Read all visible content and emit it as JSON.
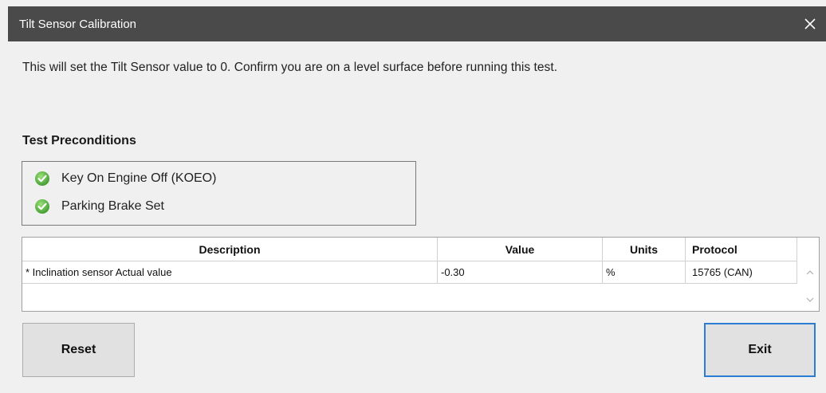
{
  "window": {
    "title": "Tilt Sensor Calibration",
    "close_icon": "close-icon"
  },
  "info_text": "This will set the Tilt Sensor value to 0. Confirm you are on a level surface before running this test.",
  "preconditions": {
    "title": "Test Preconditions",
    "items": [
      {
        "label": "Key On Engine Off (KOEO)",
        "status": "ok",
        "icon": "check-circle-icon"
      },
      {
        "label": "Parking Brake Set",
        "status": "ok",
        "icon": "check-circle-icon"
      }
    ]
  },
  "grid": {
    "columns": [
      "Description",
      "Value",
      "Units",
      "Protocol"
    ],
    "rows": [
      {
        "description": "* Inclination sensor Actual value",
        "value": "-0.30",
        "units": "%",
        "protocol": "15765 (CAN)"
      }
    ]
  },
  "buttons": {
    "reset": "Reset",
    "exit": "Exit"
  },
  "colors": {
    "titlebar": "#4a4a4a",
    "check_green": "#4caf50",
    "focus_border": "#2b7cd3"
  }
}
